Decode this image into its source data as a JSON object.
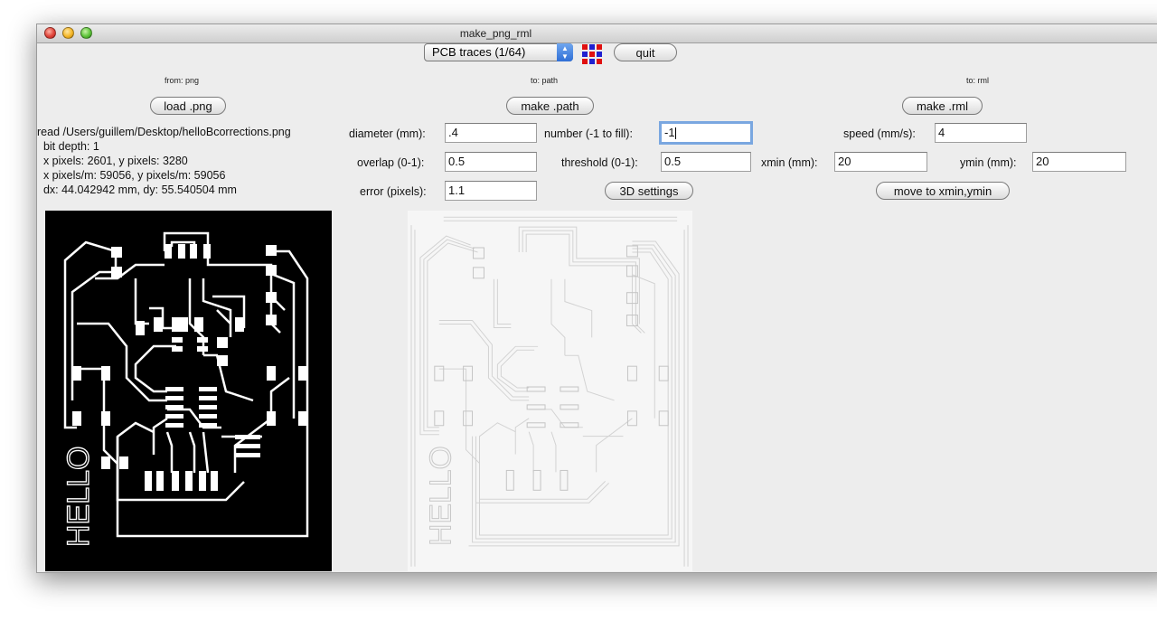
{
  "window": {
    "title": "make_png_rml"
  },
  "toolbar": {
    "format_select": "PCB traces (1/64)",
    "quit_label": "quit",
    "color_grid_icon": "color-grid-icon"
  },
  "columns": {
    "from_label": "from: png",
    "to_path_label": "to: path",
    "to_rml_label": "to: rml"
  },
  "buttons": {
    "load_png": "load .png",
    "make_path": "make .path",
    "make_rml": "make .rml",
    "settings_3d": "3D settings",
    "move_to": "move to xmin,ymin"
  },
  "png_info": {
    "line1": "read /Users/guillem/Desktop/helloBcorrections.png",
    "line2": "  bit depth: 1",
    "line3": "  x pixels: 2601, y pixels: 3280",
    "line4": "  x pixels/m: 59056, y pixels/m: 59056",
    "line5": "  dx: 44.042942 mm, dy: 55.540504 mm"
  },
  "path_fields": {
    "diameter_label": "diameter (mm):",
    "diameter_value": ".4",
    "overlap_label": "overlap (0-1):",
    "overlap_value": "0.5",
    "error_label": "error (pixels):",
    "error_value": "1.1",
    "number_label": "number (-1 to fill):",
    "number_value": "-1",
    "threshold_label": "threshold (0-1):",
    "threshold_value": "0.5"
  },
  "rml_fields": {
    "speed_label": "speed (mm/s):",
    "speed_value": "4",
    "xmin_label": "xmin (mm):",
    "xmin_value": "20",
    "ymin_label": "ymin (mm):",
    "ymin_value": "20"
  },
  "board": {
    "text": "HELLO"
  },
  "colors": {
    "window_bg": "#ededed",
    "select_accent": "#2f6fd6",
    "grid_red": "#e01010",
    "grid_blue": "#2020d0"
  }
}
